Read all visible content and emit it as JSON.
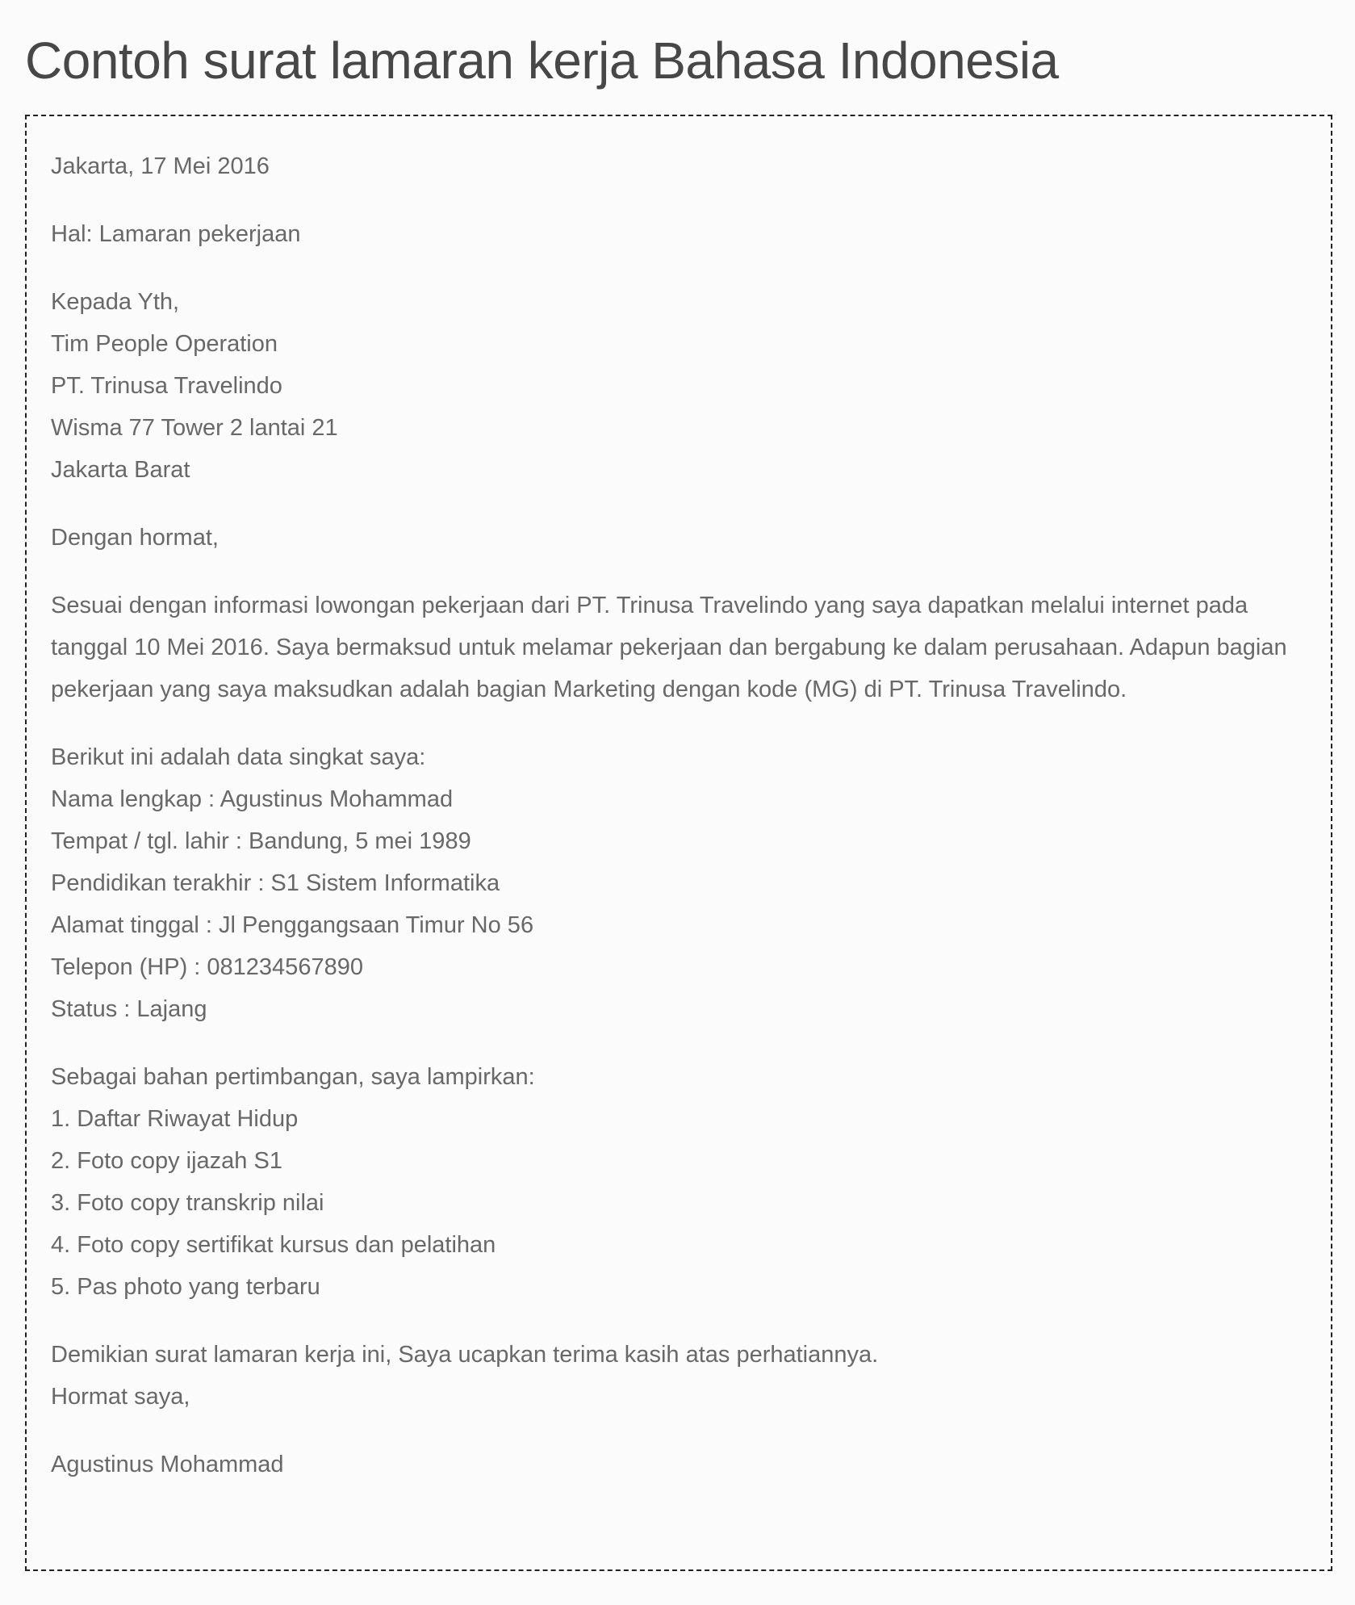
{
  "page": {
    "title": "Contoh surat lamaran kerja Bahasa Indonesia"
  },
  "letter": {
    "date_line": "Jakarta, 17 Mei 2016",
    "subject": "Hal: Lamaran pekerjaan",
    "recipient": [
      "Kepada Yth,",
      "Tim People Operation",
      "PT. Trinusa Travelindo",
      "Wisma 77 Tower 2 lantai 21",
      "Jakarta Barat"
    ],
    "salutation": "Dengan hormat,",
    "body_paragraph": "Sesuai dengan informasi lowongan pekerjaan dari PT. Trinusa Travelindo yang saya dapatkan melalui internet pada tanggal 10 Mei 2016. Saya bermaksud untuk melamar pekerjaan dan bergabung ke dalam perusahaan. Adapun bagian pekerjaan yang saya maksudkan adalah bagian Marketing dengan kode (MG) di PT. Trinusa Travelindo.",
    "personal_data_intro": "Berikut ini adalah data singkat saya:",
    "personal_data": [
      "Nama lengkap : Agustinus Mohammad",
      "Tempat / tgl. lahir : Bandung, 5 mei 1989",
      "Pendidikan terakhir : S1 Sistem Informatika",
      "Alamat tinggal : Jl Penggangsaan Timur No 56",
      "Telepon (HP) : 081234567890",
      "Status : Lajang"
    ],
    "attachments_intro": "Sebagai bahan pertimbangan, saya lampirkan:",
    "attachments": [
      "1. Daftar Riwayat Hidup",
      "2. Foto copy ijazah S1",
      "3. Foto copy transkrip nilai",
      "4. Foto copy sertifikat kursus dan pelatihan",
      "5. Pas photo yang terbaru"
    ],
    "closing": [
      "Demikian surat lamaran kerja ini, Saya ucapkan terima kasih atas perhatiannya.",
      "Hormat saya,"
    ],
    "signature": "Agustinus Mohammad"
  }
}
